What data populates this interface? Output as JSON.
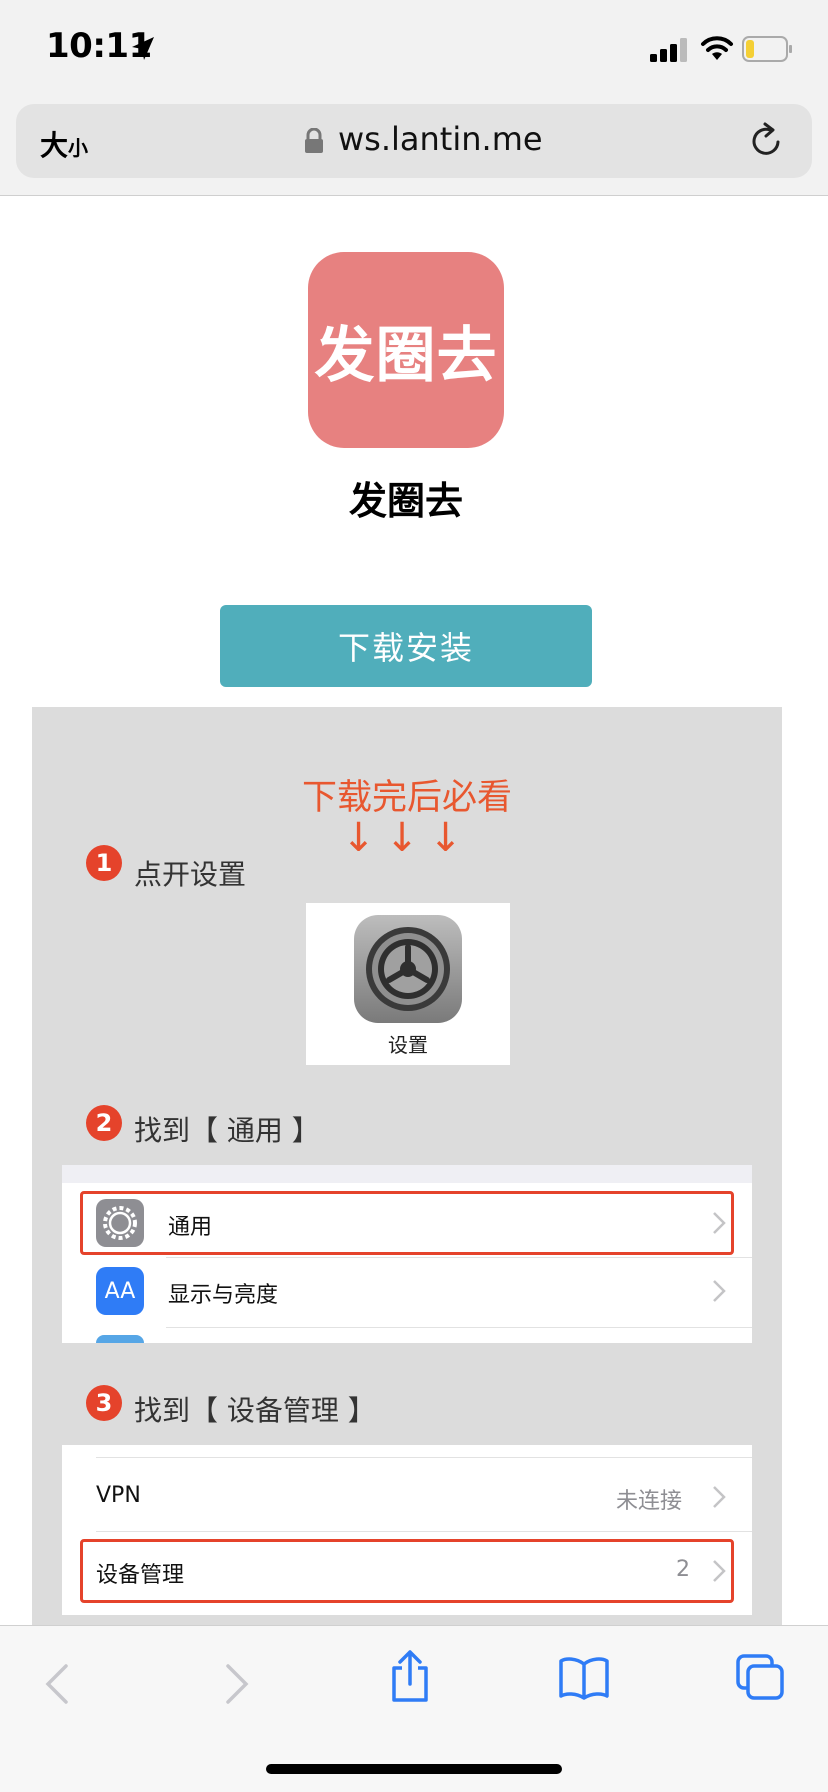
{
  "status_bar": {
    "time": "10:11"
  },
  "browser": {
    "text_size_label": "大",
    "text_size_small": "小",
    "url": "ws.lantin.me"
  },
  "app": {
    "icon_text": "发圈去",
    "name": "发圈去",
    "icon_color": "#e78180"
  },
  "install_button": {
    "label": "下载安装",
    "color": "#50aebb"
  },
  "guide": {
    "title": "下载完后必看",
    "arrows": "↓↓↓",
    "accent_color": "#e8572f",
    "steps": [
      {
        "num": "1",
        "label": "点开设置"
      },
      {
        "num": "2",
        "label": "找到【 通用 】"
      },
      {
        "num": "3",
        "label": "找到【 设备管理 】"
      }
    ],
    "settings_card_label": "设置",
    "general_list": [
      {
        "label": "通用",
        "icon": "gear-icon"
      },
      {
        "label": "显示与亮度",
        "icon": "text-size-icon",
        "icon_text": "AA"
      }
    ],
    "device_list": [
      {
        "label": "VPN",
        "value": "未连接"
      },
      {
        "label": "设备管理",
        "value": "2"
      }
    ]
  },
  "toolbar": {
    "items": [
      "back-icon",
      "forward-icon",
      "share-icon",
      "bookmarks-icon",
      "tabs-icon"
    ]
  }
}
